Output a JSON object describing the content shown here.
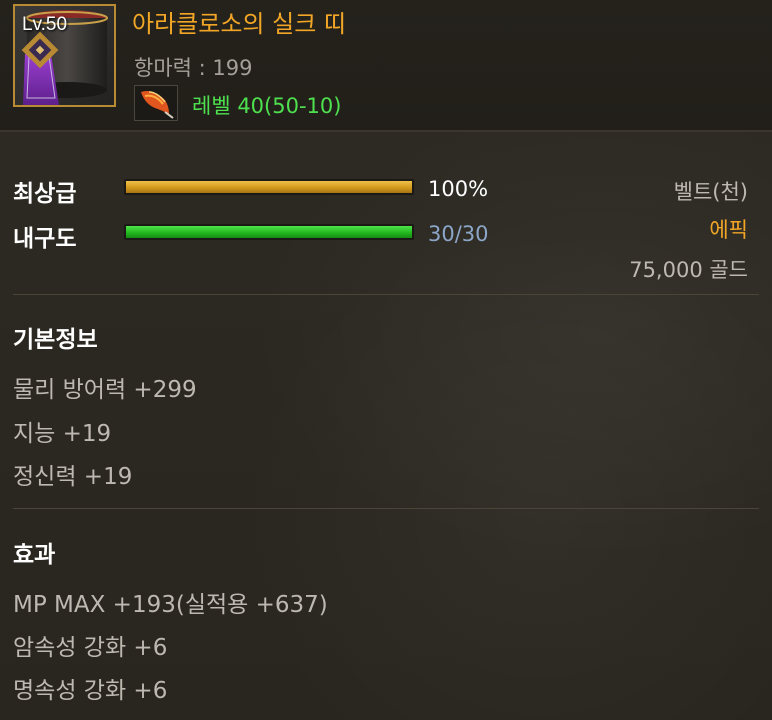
{
  "item": {
    "level_badge": "Lv.50",
    "name": "아라클로소의 실크 띠",
    "magic_resist": "항마력 : 199",
    "requirement": "레벨 40(50-10)",
    "icon": "silk-belt-icon",
    "requirement_icon": "feather-quill-icon"
  },
  "stats": {
    "grade_label": "최상급",
    "grade_value": "100%",
    "grade_fraction": 1.0,
    "durability_label": "내구도",
    "durability_value": "30/30",
    "durability_fraction": 1.0
  },
  "meta": {
    "type": "벨트(천)",
    "rarity": "에픽",
    "price": "75,000 골드"
  },
  "basic_info": {
    "title": "기본정보",
    "lines": [
      "물리 방어력 +299",
      "지능 +19",
      "정신력 +19"
    ]
  },
  "effects": {
    "title": "효과",
    "lines": [
      "MP MAX +193(실적용 +637)",
      "암속성 강화 +6",
      "명속성 강화 +6"
    ]
  },
  "colors": {
    "item_name": "#f2a626",
    "requirement_met": "#4ee04e",
    "rarity_epic": "#f2a626",
    "durability_value": "#8ca6c8"
  }
}
